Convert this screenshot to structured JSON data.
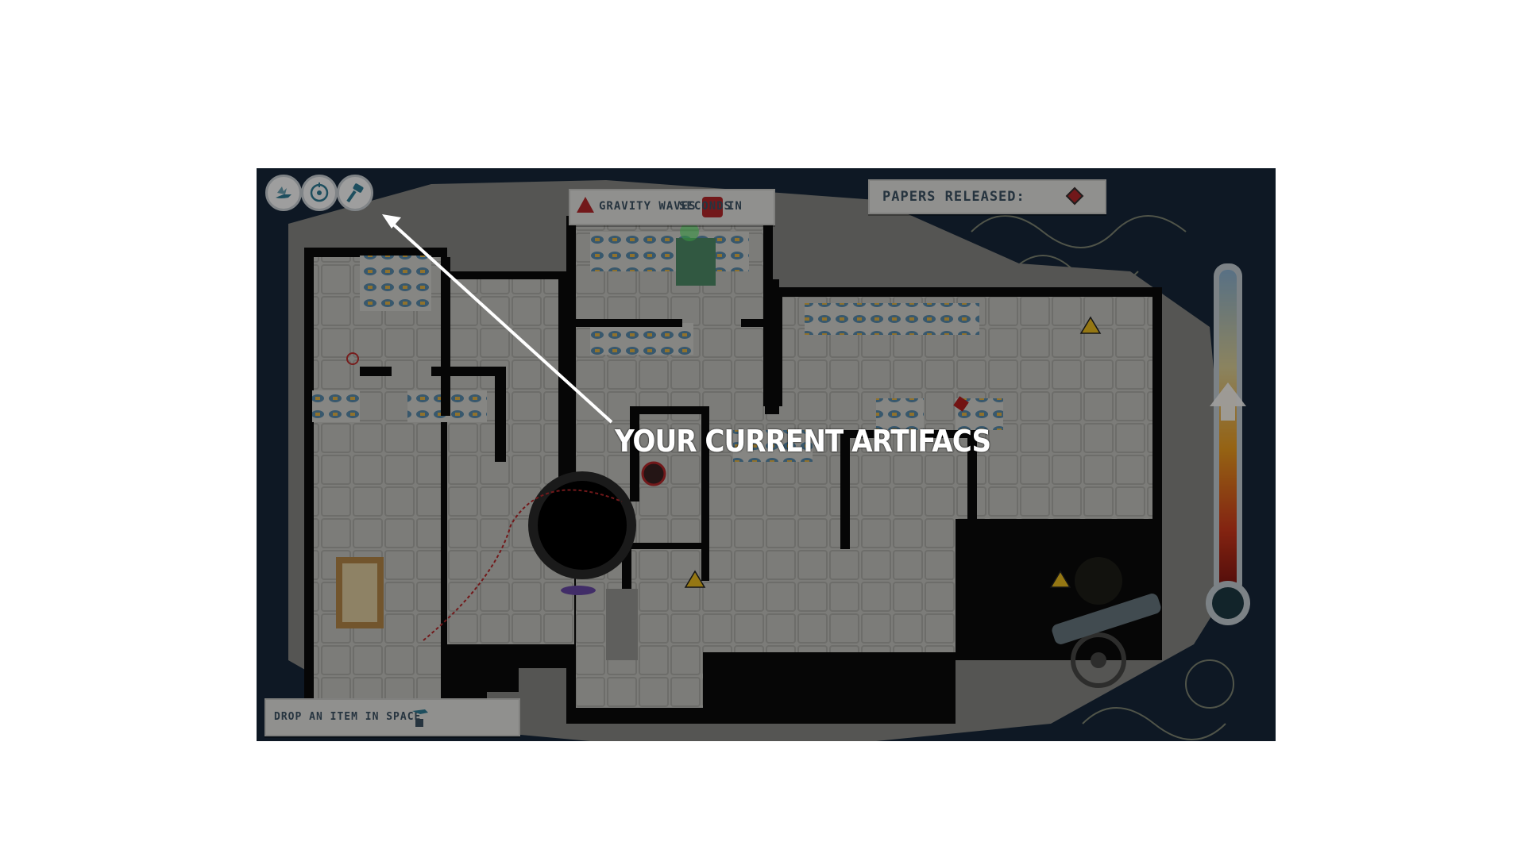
{
  "hud": {
    "gravity_label": "Gravity Waves",
    "gravity_in": "In",
    "gravity_seconds": "Seconds",
    "papers_label": "Papers Released:",
    "drop_item_label": "Drop an item in space"
  },
  "artifacts": [
    {
      "name": "winged-sandal-icon"
    },
    {
      "name": "compass-icon"
    },
    {
      "name": "hammer-icon"
    }
  ],
  "tutorial": {
    "label": "YOUR CURRENT ARTIFACS"
  },
  "colors": {
    "space": "#13202b",
    "hull": "#8a8a86",
    "floor": "#c9c9c4",
    "wall": "#0b0b0b",
    "hud_text": "#3e5466",
    "accent_red": "#b8282a",
    "artifact_icon": "#2f7f98"
  }
}
